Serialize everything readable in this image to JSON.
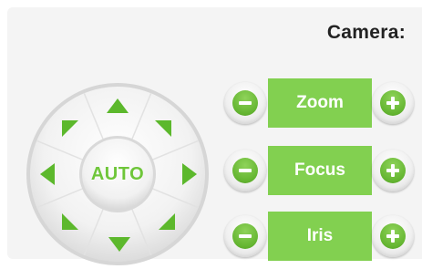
{
  "panel": {
    "title": "Camera:"
  },
  "ptz": {
    "center_label": "AUTO",
    "directions": [
      "up",
      "up-right",
      "right",
      "down-right",
      "down",
      "down-left",
      "left",
      "up-left"
    ]
  },
  "controls": [
    {
      "label": "Zoom",
      "minus_icon": "minus-icon",
      "plus_icon": "plus-icon"
    },
    {
      "label": "Focus",
      "minus_icon": "minus-icon",
      "plus_icon": "plus-icon"
    },
    {
      "label": "Iris",
      "minus_icon": "minus-icon",
      "plus_icon": "plus-icon"
    }
  ],
  "colors": {
    "accent": "#82d050",
    "arrow": "#5cb82c",
    "panel_bg": "#f4f4f4"
  }
}
